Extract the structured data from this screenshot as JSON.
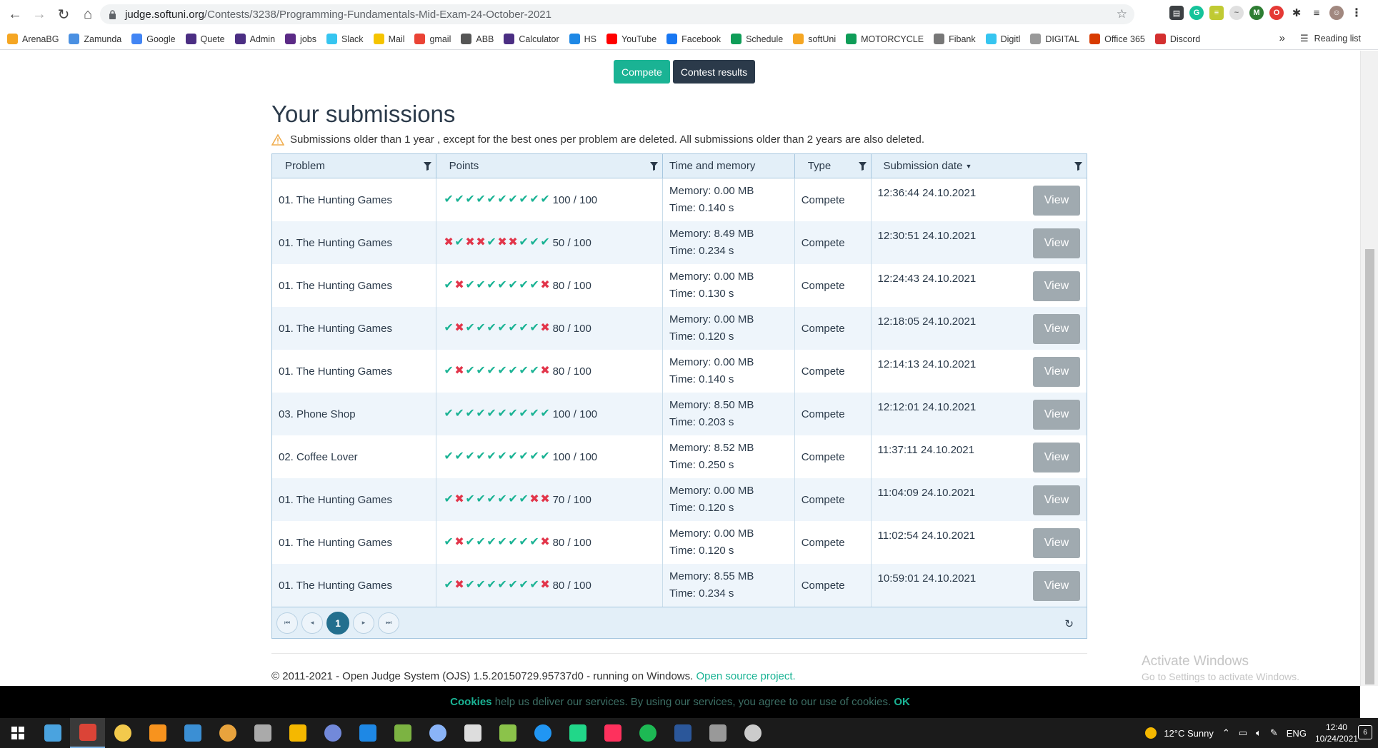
{
  "browser": {
    "url_host": "judge.softuni.org",
    "url_path": "/Contests/3238/Programming-Fundamentals-Mid-Exam-24-October-2021",
    "bookmarks": [
      {
        "label": "ArenaBG",
        "color": "#f5a623",
        "icon": "arenabg-icon"
      },
      {
        "label": "Zamunda",
        "color": "#4a90e2",
        "icon": "zamunda-icon"
      },
      {
        "label": "Google",
        "color": "#4285f4",
        "icon": "google-icon"
      },
      {
        "label": "Quete",
        "color": "#4b2e83",
        "icon": "quete-icon"
      },
      {
        "label": "Admin",
        "color": "#4b2e83",
        "icon": "admin-icon"
      },
      {
        "label": "jobs",
        "color": "#5b2a86",
        "icon": "jobs-icon"
      },
      {
        "label": "Slack",
        "color": "#36c5f0",
        "icon": "slack-icon"
      },
      {
        "label": "Mail",
        "color": "#f5c400",
        "icon": "mail-icon"
      },
      {
        "label": "gmail",
        "color": "#ea4335",
        "icon": "gmail-icon"
      },
      {
        "label": "ABB",
        "color": "#555555",
        "icon": "home-icon"
      },
      {
        "label": "Calculator",
        "color": "#4b2e83",
        "icon": "calculator-icon"
      },
      {
        "label": "HS",
        "color": "#1e88e5",
        "icon": "hs-icon"
      },
      {
        "label": "YouTube",
        "color": "#ff0000",
        "icon": "youtube-icon"
      },
      {
        "label": "Facebook",
        "color": "#1877f2",
        "icon": "facebook-icon"
      },
      {
        "label": "Schedule",
        "color": "#0f9d58",
        "icon": "schedule-icon"
      },
      {
        "label": "softUni",
        "color": "#f5a623",
        "icon": "softuni-icon"
      },
      {
        "label": "MOTORCYCLE",
        "color": "#0f9d58",
        "icon": "motorcycle-icon"
      },
      {
        "label": "Fibank",
        "color": "#777777",
        "icon": "fibank-icon"
      },
      {
        "label": "Digitl",
        "color": "#36c5f0",
        "icon": "digitl-icon"
      },
      {
        "label": "DIGITAL",
        "color": "#999999",
        "icon": "digital-icon"
      },
      {
        "label": "Office 365",
        "color": "#d83b01",
        "icon": "office-icon"
      },
      {
        "label": "Discord",
        "color": "#d32f2f",
        "icon": "discord-icon"
      }
    ],
    "more_bookmarks": "»",
    "reading_list": "Reading list"
  },
  "page": {
    "compete_label": "Compete",
    "results_label": "Contest results",
    "title": "Your submissions",
    "notice": "Submissions older than 1 year , except for the best ones per problem are deleted. All submissions older than 2 years are also deleted.",
    "columns": {
      "problem": "Problem",
      "points": "Points",
      "time_memory": "Time and memory",
      "type": "Type",
      "date": "Submission date",
      "sort_indicator": "▼"
    },
    "view_label": "View",
    "rows": [
      {
        "problem": "01. The Hunting Games",
        "tests": "1111111111",
        "score": "100 / 100",
        "memory": "Memory: 0.00 MB",
        "time": "Time: 0.140 s",
        "type": "Compete",
        "date": "12:36:44 24.10.2021"
      },
      {
        "problem": "01. The Hunting Games",
        "tests": "0100100111",
        "score": "50 / 100",
        "memory": "Memory: 8.49 MB",
        "time": "Time: 0.234 s",
        "type": "Compete",
        "date": "12:30:51 24.10.2021"
      },
      {
        "problem": "01. The Hunting Games",
        "tests": "1011111110",
        "score": "80 / 100",
        "memory": "Memory: 0.00 MB",
        "time": "Time: 0.130 s",
        "type": "Compete",
        "date": "12:24:43 24.10.2021"
      },
      {
        "problem": "01. The Hunting Games",
        "tests": "1011111110",
        "score": "80 / 100",
        "memory": "Memory: 0.00 MB",
        "time": "Time: 0.120 s",
        "type": "Compete",
        "date": "12:18:05 24.10.2021"
      },
      {
        "problem": "01. The Hunting Games",
        "tests": "1011111110",
        "score": "80 / 100",
        "memory": "Memory: 0.00 MB",
        "time": "Time: 0.140 s",
        "type": "Compete",
        "date": "12:14:13 24.10.2021"
      },
      {
        "problem": "03. Phone Shop",
        "tests": "1111111111",
        "score": "100 / 100",
        "memory": "Memory: 8.50 MB",
        "time": "Time: 0.203 s",
        "type": "Compete",
        "date": "12:12:01 24.10.2021"
      },
      {
        "problem": "02. Coffee Lover",
        "tests": "1111111111",
        "score": "100 / 100",
        "memory": "Memory: 8.52 MB",
        "time": "Time: 0.250 s",
        "type": "Compete",
        "date": "11:37:11 24.10.2021"
      },
      {
        "problem": "01. The Hunting Games",
        "tests": "1011111100",
        "score": "70 / 100",
        "memory": "Memory: 0.00 MB",
        "time": "Time: 0.120 s",
        "type": "Compete",
        "date": "11:04:09 24.10.2021"
      },
      {
        "problem": "01. The Hunting Games",
        "tests": "1011111110",
        "score": "80 / 100",
        "memory": "Memory: 0.00 MB",
        "time": "Time: 0.120 s",
        "type": "Compete",
        "date": "11:02:54 24.10.2021"
      },
      {
        "problem": "01. The Hunting Games",
        "tests": "1011111110",
        "score": "80 / 100",
        "memory": "Memory: 8.55 MB",
        "time": "Time: 0.234 s",
        "type": "Compete",
        "date": "10:59:01 24.10.2021"
      }
    ],
    "pager": {
      "current_page": "1",
      "first": "⏮",
      "prev": "◂",
      "next": "▸",
      "last": "⏭",
      "refresh": "↻"
    },
    "footer_text": "© 2011-2021 - Open Judge System (OJS) 1.5.20150729.95737d0 - running on Windows. ",
    "footer_link": "Open source project.",
    "activate_line1": "Activate Windows",
    "activate_line2": "Go to Settings to activate Windows.",
    "cookies_brand": "Cookies",
    "cookies_text": " help us deliver our services. By using our services, you agree to our use of cookies. ",
    "cookies_ok": "OK"
  },
  "colors": {
    "accent": "#1ab394",
    "dark": "#2b3a4a",
    "error": "#e2354a",
    "header_bg": "#e3eff8"
  },
  "taskbar": {
    "apps": [
      {
        "name": "start-icon",
        "color": "#ffffff"
      },
      {
        "name": "task-view-icon",
        "color": "#4aa3df"
      },
      {
        "name": "chrome-icon",
        "color": "#db4437",
        "active": true
      },
      {
        "name": "file-explorer-icon",
        "color": "#f2c94c"
      },
      {
        "name": "orange-app-icon",
        "color": "#f7931e"
      },
      {
        "name": "blue-app-icon",
        "color": "#3b8fd4"
      },
      {
        "name": "circle-app-icon",
        "color": "#e8a33d"
      },
      {
        "name": "settings-app-icon",
        "color": "#aaaaaa"
      },
      {
        "name": "bitdefender-icon",
        "color": "#f5b800"
      },
      {
        "name": "discord-app-icon",
        "color": "#7289da"
      },
      {
        "name": "blue-arrow-icon",
        "color": "#1e88e5"
      },
      {
        "name": "green-circle-icon",
        "color": "#7cb342"
      },
      {
        "name": "cube-icon",
        "color": "#8ab4f8"
      },
      {
        "name": "terminal-icon",
        "color": "#dddddd"
      },
      {
        "name": "notepad-icon",
        "color": "#8bc34a"
      },
      {
        "name": "vscode-icon",
        "color": "#2196f3"
      },
      {
        "name": "pycharm-icon",
        "color": "#21d789"
      },
      {
        "name": "intellij-icon",
        "color": "#fe315d"
      },
      {
        "name": "spotify-icon",
        "color": "#1db954"
      },
      {
        "name": "word-icon",
        "color": "#2b579a"
      },
      {
        "name": "calculator-app-icon",
        "color": "#999999"
      },
      {
        "name": "snipping-icon",
        "color": "#cccccc"
      }
    ],
    "weather": "12°C  Sunny",
    "language": "ENG",
    "time": "12:40",
    "date": "10/24/2021",
    "notifications": "6"
  }
}
